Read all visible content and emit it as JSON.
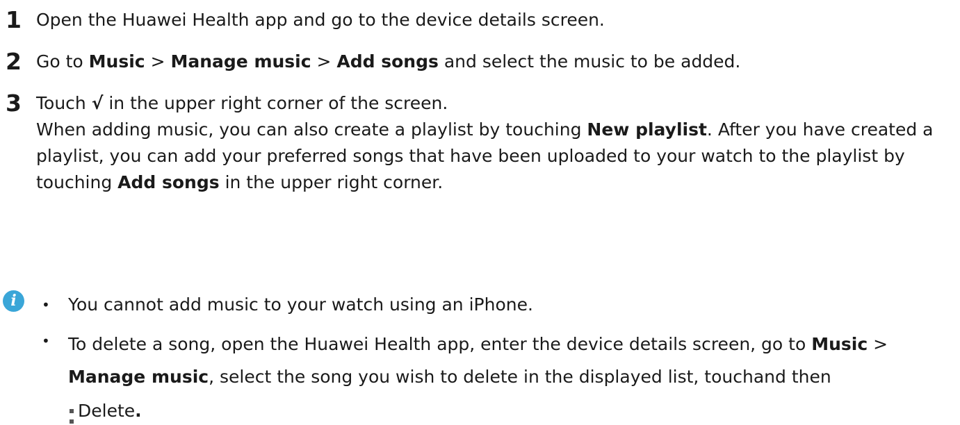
{
  "steps": [
    {
      "number": "1",
      "text": "Open the Huawei Health app and go to the device details screen."
    },
    {
      "number": "2",
      "parts": [
        "Go to ",
        "Music",
        " > ",
        "Manage music",
        " > ",
        "Add songs",
        " and select the music to be added."
      ]
    },
    {
      "number": "3",
      "line1_parts": [
        "Touch ",
        "√",
        " in the upper right corner of the screen."
      ],
      "line2_parts": [
        "When adding music, you can also create a playlist by touching ",
        "New playlist",
        ". After you have created a playlist, you can add your preferred songs that have been uploaded to your watch to the playlist by touching ",
        "Add songs",
        " in the upper right corner."
      ]
    }
  ],
  "note": {
    "icon": "info-icon",
    "icon_glyph": "i",
    "bullets": [
      {
        "text": "You cannot add music to your watch using an iPhone."
      },
      {
        "parts": [
          "To delete a song, open the Huawei Health app, enter the device details screen, go to ",
          "Music",
          " > ",
          "Manage music",
          ", select the song you wish to delete in the displayed list, touch",
          "and then ",
          "Delete",
          "."
        ],
        "icon": "more-vertical-icon"
      }
    ],
    "bullet_glyph": "•"
  }
}
